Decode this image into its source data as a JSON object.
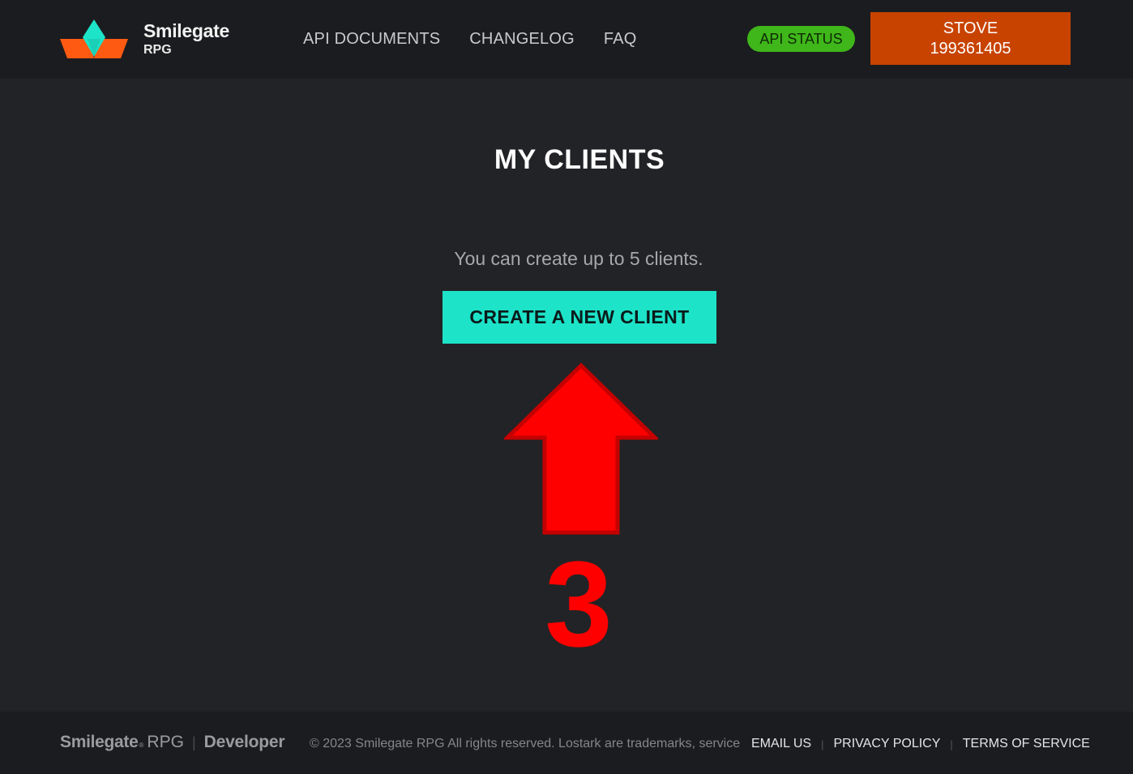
{
  "header": {
    "logo": {
      "word": "Smilegate",
      "sub": "RPG"
    },
    "nav": [
      {
        "label": "API DOCUMENTS"
      },
      {
        "label": "CHANGELOG"
      },
      {
        "label": "FAQ"
      }
    ],
    "api_status_label": "API STATUS",
    "stove": {
      "line1": "STOVE",
      "line2": "199361405"
    }
  },
  "main": {
    "title": "MY CLIENTS",
    "subtitle": "You can create up to 5 clients.",
    "create_button_label": "CREATE A NEW CLIENT",
    "annotation": {
      "step_number": "3",
      "arrow_color": "#ff0000",
      "arrow_icon": "arrow-up-icon"
    }
  },
  "footer": {
    "logo": {
      "brand": "Smilegate",
      "reg": "®",
      "rpg": "RPG",
      "sep": "|",
      "dev": "Developer"
    },
    "copyright": "© 2023 Smilegate RPG All rights reserved. Lostark are trademarks, service",
    "links": [
      {
        "label": "EMAIL US"
      },
      {
        "label": "PRIVACY POLICY"
      },
      {
        "label": "TERMS OF SERVICE"
      }
    ],
    "link_separator": "|"
  },
  "colors": {
    "background": "#222326",
    "header_bg": "#1b1c1f",
    "api_status": "#3fb61a",
    "stove_button": "#c84300",
    "create_button": "#1de3c8",
    "logo_diamond": "#1de3c8",
    "logo_wings": "#ff5a12"
  }
}
